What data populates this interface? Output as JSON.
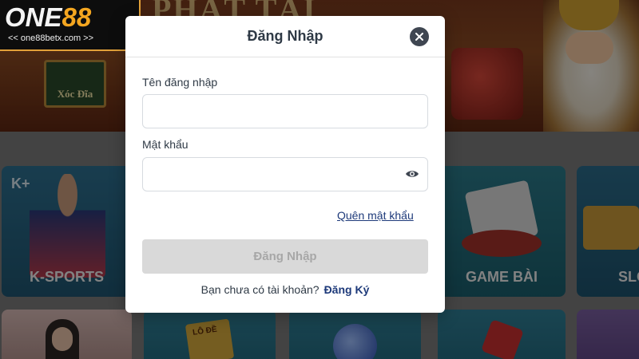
{
  "brand": {
    "logo_prefix": "ONE",
    "logo_suffix": "88",
    "url": "<< one88betx.com >>"
  },
  "banner": {
    "title_text": "PHÁT TÀI",
    "game_label": "Xóc Đĩa"
  },
  "categories": {
    "ksports_badge": "K+",
    "ksports_label": "K-SPORTS",
    "gamebai_label": "GAME BÀI",
    "slot_label": "SLO",
    "lode_label": "LÔ ĐỀ"
  },
  "modal": {
    "title": "Đăng Nhập",
    "username_label": "Tên đăng nhập",
    "username_value": "",
    "username_placeholder": "",
    "password_label": "Mật khẩu",
    "password_value": "",
    "password_placeholder": "",
    "forgot_password": "Quên mật khẩu",
    "submit_label": "Đăng Nhập",
    "no_account_text": "Bạn chưa có tài khoản?",
    "register_link": "Đăng Ký"
  },
  "colors": {
    "accent_orange": "#f4a620",
    "link_blue": "#1e3a7a",
    "button_disabled": "#d9d9d9"
  },
  "icons": {
    "close": "close-icon",
    "show_password": "eye-icon"
  }
}
